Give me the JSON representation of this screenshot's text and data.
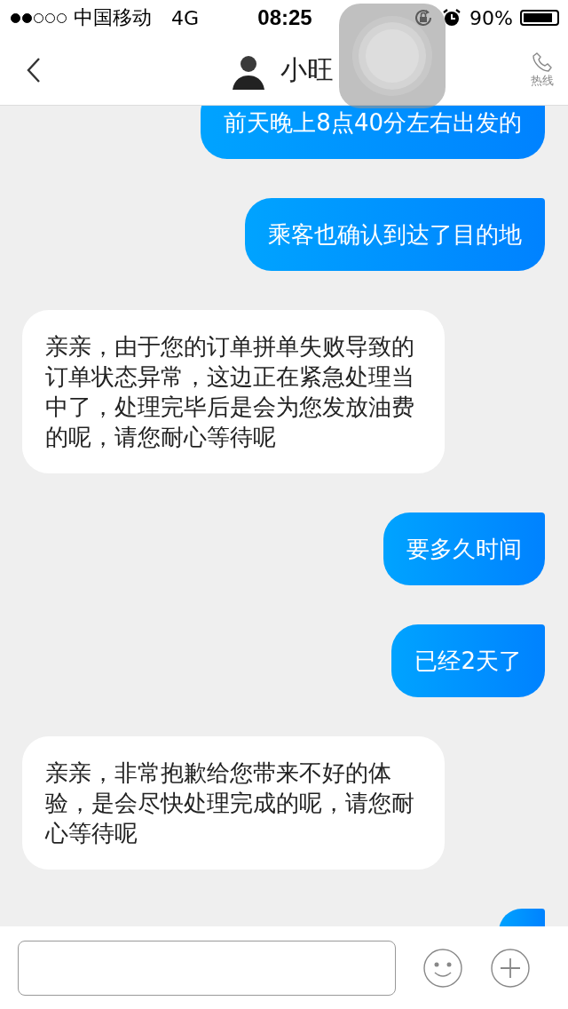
{
  "status_bar": {
    "carrier": "中国移动",
    "network": "4G",
    "time": "08:25",
    "battery": "90%"
  },
  "header": {
    "title": "小旺",
    "hotline": "热线"
  },
  "messages": [
    {
      "kind": "outgoing",
      "text": "前天晚上8点40分左右出发的"
    },
    {
      "kind": "outgoing",
      "text": "乘客也确认到达了目的地"
    },
    {
      "kind": "incoming",
      "text": "亲亲，由于您的订单拼单失败导致的订单状态异常，这边正在紧急处理当中了，处理完毕后是会为您发放油费的呢，请您耐心等待呢"
    },
    {
      "kind": "outgoing",
      "text": "要多久时间"
    },
    {
      "kind": "outgoing",
      "text": "已经2天了"
    },
    {
      "kind": "incoming",
      "text": "亲亲，非常抱歉给您带来不好的体验，是会尽快处理完成的呢，请您耐心等待呢"
    },
    {
      "kind": "outgoing"
    }
  ]
}
